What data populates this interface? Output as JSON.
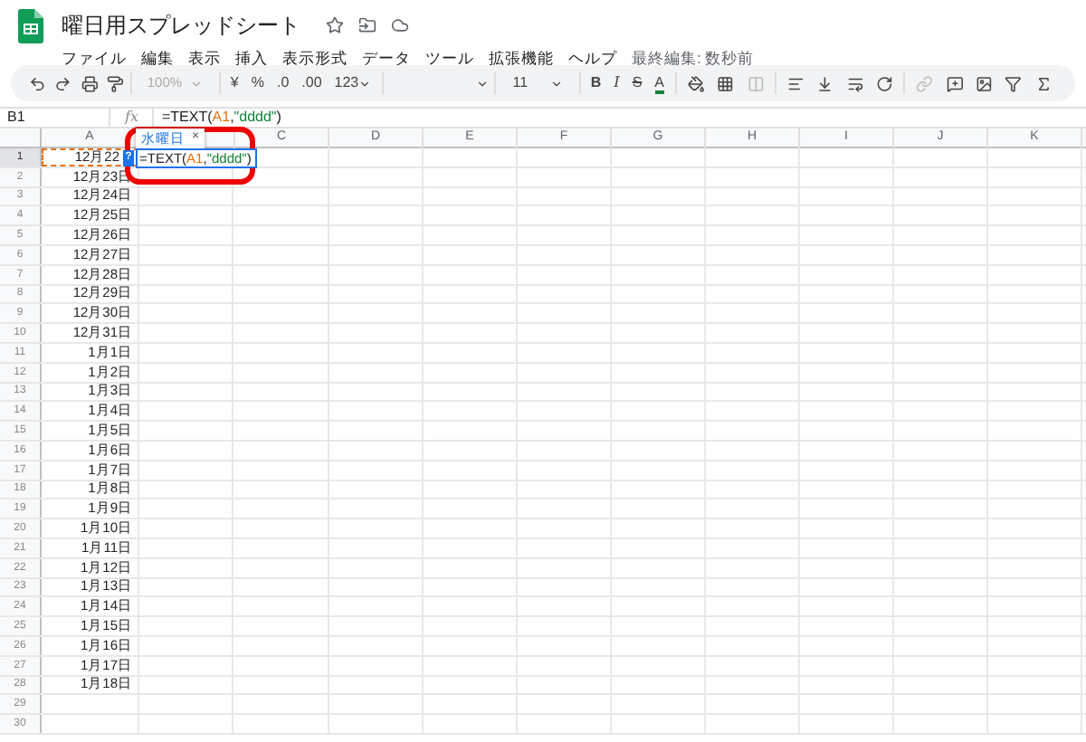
{
  "title": "曜日用スプレッドシート",
  "menus": [
    "ファイル",
    "編集",
    "表示",
    "挿入",
    "表示形式",
    "データ",
    "ツール",
    "拡張機能",
    "ヘルプ"
  ],
  "last_edit": "最終編集: 数秒前",
  "toolbar": {
    "zoom": "100%",
    "currency": "¥",
    "percent": "%",
    "decrease_decimal": ".0",
    "increase_decimal": ".00",
    "number_format": "123",
    "font_size": "11",
    "bold": "B",
    "italic": "I",
    "strike": "S",
    "text_color": "A"
  },
  "formula_bar": {
    "cell": "B1",
    "fx": "fx",
    "formula": [
      {
        "text": "=TEXT(",
        "kind": "plain"
      },
      {
        "text": "A1",
        "kind": "ref"
      },
      {
        "text": ",",
        "kind": "plain"
      },
      {
        "text": "\"dddd\"",
        "kind": "string"
      },
      {
        "text": ")",
        "kind": "plain"
      }
    ]
  },
  "columns": [
    "A",
    "C",
    "D",
    "E",
    "F",
    "G",
    "H",
    "I",
    "J",
    "K"
  ],
  "rows": [
    {
      "number": "1",
      "a": "12月22",
      "selected": true,
      "referenced": true
    },
    {
      "number": "2",
      "a": "12月23日",
      "selected": false,
      "referenced": false
    },
    {
      "number": "3",
      "a": "12月24日",
      "selected": false,
      "referenced": false
    },
    {
      "number": "4",
      "a": "12月25日",
      "selected": false,
      "referenced": false
    },
    {
      "number": "5",
      "a": "12月26日",
      "selected": false,
      "referenced": false
    },
    {
      "number": "6",
      "a": "12月27日",
      "selected": false,
      "referenced": false
    },
    {
      "number": "7",
      "a": "12月28日",
      "selected": false,
      "referenced": false
    },
    {
      "number": "8",
      "a": "12月29日",
      "selected": false,
      "referenced": false
    },
    {
      "number": "9",
      "a": "12月30日",
      "selected": false,
      "referenced": false
    },
    {
      "number": "10",
      "a": "12月31日",
      "selected": false,
      "referenced": false
    },
    {
      "number": "11",
      "a": "1月1日",
      "selected": false,
      "referenced": false
    },
    {
      "number": "12",
      "a": "1月2日",
      "selected": false,
      "referenced": false
    },
    {
      "number": "13",
      "a": "1月3日",
      "selected": false,
      "referenced": false
    },
    {
      "number": "14",
      "a": "1月4日",
      "selected": false,
      "referenced": false
    },
    {
      "number": "15",
      "a": "1月5日",
      "selected": false,
      "referenced": false
    },
    {
      "number": "16",
      "a": "1月6日",
      "selected": false,
      "referenced": false
    },
    {
      "number": "17",
      "a": "1月7日",
      "selected": false,
      "referenced": false
    },
    {
      "number": "18",
      "a": "1月8日",
      "selected": false,
      "referenced": false
    },
    {
      "number": "19",
      "a": "1月9日",
      "selected": false,
      "referenced": false
    },
    {
      "number": "20",
      "a": "1月10日",
      "selected": false,
      "referenced": false
    },
    {
      "number": "21",
      "a": "1月11日",
      "selected": false,
      "referenced": false
    },
    {
      "number": "22",
      "a": "1月12日",
      "selected": false,
      "referenced": false
    },
    {
      "number": "23",
      "a": "1月13日",
      "selected": false,
      "referenced": false
    },
    {
      "number": "24",
      "a": "1月14日",
      "selected": false,
      "referenced": false
    },
    {
      "number": "25",
      "a": "1月15日",
      "selected": false,
      "referenced": false
    },
    {
      "number": "26",
      "a": "1月16日",
      "selected": false,
      "referenced": false
    },
    {
      "number": "27",
      "a": "1月17日",
      "selected": false,
      "referenced": false
    },
    {
      "number": "28",
      "a": "1月18日",
      "selected": false,
      "referenced": false
    },
    {
      "number": "29",
      "selected": false,
      "referenced": false
    },
    {
      "number": "30",
      "selected": false,
      "referenced": false
    }
  ],
  "editor": {
    "formula": [
      {
        "text": "=TEXT(",
        "kind": "plain"
      },
      {
        "text": "A1",
        "kind": "ref"
      },
      {
        "text": ",",
        "kind": "plain"
      },
      {
        "text": "\"dddd\"",
        "kind": "string"
      },
      {
        "text": ")",
        "kind": "plain"
      }
    ]
  },
  "preview": {
    "result": "水曜日",
    "close": "×",
    "help": "?"
  }
}
